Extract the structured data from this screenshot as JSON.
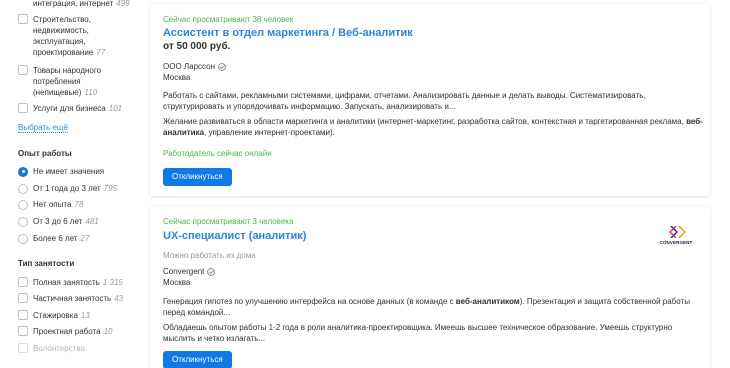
{
  "sidebar": {
    "industries": [
      {
        "label": "интеграция, интернет",
        "count": "499"
      },
      {
        "label": "Строительство, недвижимость, эксплуатация, проектирование",
        "count": "77"
      },
      {
        "label": "Товары народного потребления (непищевые)",
        "count": "110"
      },
      {
        "label": "Услуги для бизнеса",
        "count": "101"
      }
    ],
    "show_more": "Выбрать ещё",
    "experience": {
      "title": "Опыт работы",
      "options": [
        {
          "label": "Не имеет значения",
          "count": "",
          "selected": true
        },
        {
          "label": "От 1 года до 3 лет",
          "count": "795",
          "selected": false
        },
        {
          "label": "Нет опыта",
          "count": "78",
          "selected": false
        },
        {
          "label": "От 3 до 6 лет",
          "count": "481",
          "selected": false
        },
        {
          "label": "Более 6 лет",
          "count": "27",
          "selected": false
        }
      ]
    },
    "employment": {
      "title": "Тип занятости",
      "options": [
        {
          "label": "Полная занятость",
          "count": "1 315"
        },
        {
          "label": "Частичная занятость",
          "count": "43"
        },
        {
          "label": "Стажировка",
          "count": "13"
        },
        {
          "label": "Проектная работа",
          "count": "10"
        },
        {
          "label": "Волонтерство",
          "count": ""
        }
      ]
    }
  },
  "vacancies": [
    {
      "viewers": "Сейчас просматривают 38 человек",
      "title": "Ассистент в отдел маркетинга / Веб-аналитик",
      "salary": "от 50 000 руб.",
      "company": "ООО Ларссон",
      "city": "Москва",
      "desc1": "Работать с сайтами, рекламными системами, цифрами, отчетами. Анализировать данные и делать выводы. Систематизировать, структурировать и упорядочивать информацию. Запускать, анализировать и...",
      "desc2_a": "Желание развиваться в области маркетинга и аналитики (интернет-маркетинг, разработка сайтов, контекстная и таргетированная реклама, ",
      "desc2_b": "веб-аналитика",
      "desc2_c": ", управление интернет-проектами).",
      "online": "Работодатель сейчас онлайн",
      "respond": "Откликнуться"
    },
    {
      "viewers": "Сейчас просматривают 3 человека",
      "title": "UX-специалист (аналитик)",
      "remote": "Можно работать из дома",
      "company": "Convergent",
      "city": "Москва",
      "logo_text": "CONVERGENT",
      "desc1_a": "Генерация гипотез по улучшению интерфейса на основе данных (в команде с ",
      "desc1_b": "веб-аналитиком",
      "desc1_c": "). Презентация и защита собственной работы перед командой...",
      "desc2": "Обладаешь опытом работы 1-2 года в роли аналитика-проектировщика. Имеешь высшее техническое образование. Умеешь структурно мыслить и четко излагать...",
      "respond": "Откликнуться"
    }
  ],
  "colors": {
    "accent": "#0f7ae5",
    "link": "#2a86d6",
    "green": "#4bb34b"
  }
}
